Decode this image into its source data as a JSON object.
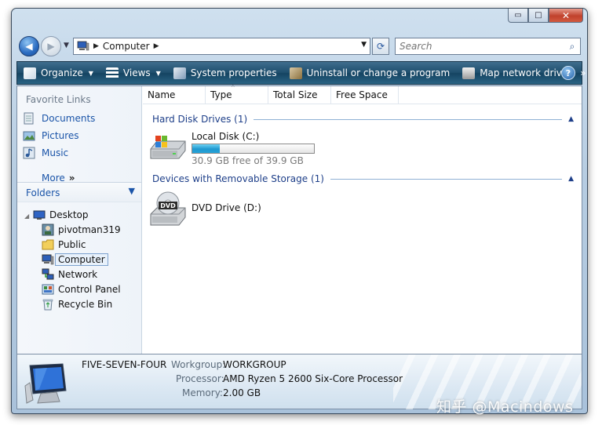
{
  "window": {
    "caption_buttons": {
      "minimize": "▭",
      "maximize": "□",
      "close": "✕"
    }
  },
  "navigation": {
    "address_crumb": "Computer",
    "search_placeholder": "Search",
    "back_glyph": "◀",
    "forward_glyph": "▶"
  },
  "command_bar": {
    "items": [
      {
        "label": "Organize",
        "icon": "organize-icon",
        "has_dropdown": true
      },
      {
        "label": "Views",
        "icon": "views-icon",
        "has_dropdown": true
      },
      {
        "label": "System properties",
        "icon": "system-properties-icon",
        "has_dropdown": false
      },
      {
        "label": "Uninstall or change a program",
        "icon": "uninstall-icon",
        "has_dropdown": false
      },
      {
        "label": "Map network drive",
        "icon": "network-drive-icon",
        "has_dropdown": false
      }
    ],
    "overflow": "»",
    "help": "?"
  },
  "favorite_links": {
    "title": "Favorite Links",
    "items": [
      {
        "label": "Documents",
        "icon": "documents-icon"
      },
      {
        "label": "Pictures",
        "icon": "pictures-icon"
      },
      {
        "label": "Music",
        "icon": "music-icon"
      }
    ],
    "more_label": "More",
    "more_chevron": "»"
  },
  "folders": {
    "title": "Folders",
    "tree": [
      {
        "label": "Desktop",
        "icon": "desktop-icon",
        "level": 0,
        "selected": false
      },
      {
        "label": "pivotman319",
        "icon": "user-folder-icon",
        "level": 1,
        "selected": false
      },
      {
        "label": "Public",
        "icon": "public-folder-icon",
        "level": 1,
        "selected": false
      },
      {
        "label": "Computer",
        "icon": "computer-icon",
        "level": 1,
        "selected": true
      },
      {
        "label": "Network",
        "icon": "network-icon",
        "level": 1,
        "selected": false
      },
      {
        "label": "Control Panel",
        "icon": "control-panel-icon",
        "level": 1,
        "selected": false
      },
      {
        "label": "Recycle Bin",
        "icon": "recycle-bin-icon",
        "level": 1,
        "selected": false
      }
    ]
  },
  "columns": [
    "Name",
    "Type",
    "Total Size",
    "Free Space"
  ],
  "groups": {
    "hard_disks": {
      "title": "Hard Disk Drives (1)",
      "drive": {
        "name": "Local Disk (C:)",
        "free_text": "30.9 GB free of 39.9 GB",
        "used_fraction": 0.226
      }
    },
    "removable": {
      "title": "Devices with Removable Storage (1)",
      "drive": {
        "name": "DVD Drive (D:)",
        "label": "DVD"
      }
    }
  },
  "details": {
    "computer_name": "FIVE-SEVEN-FOUR",
    "workgroup_label": "Workgroup:",
    "workgroup_value": "WORKGROUP",
    "processor_label": "Processor:",
    "processor_value": "AMD Ryzen 5 2600 Six-Core Processor",
    "memory_label": "Memory:",
    "memory_value": "2.00 GB"
  },
  "watermark": "知乎 @Macindows"
}
